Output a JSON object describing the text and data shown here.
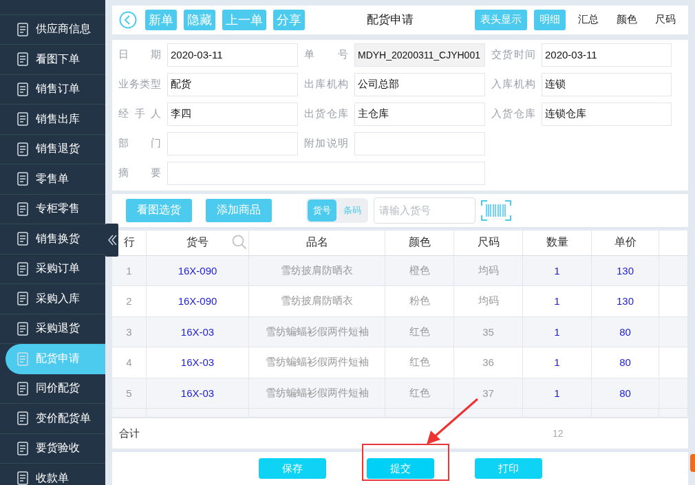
{
  "sidebar": {
    "items": [
      {
        "label": "供应商信息",
        "selected": false
      },
      {
        "label": "看图下单",
        "selected": false
      },
      {
        "label": "销售订单",
        "selected": false
      },
      {
        "label": "销售出库",
        "selected": false
      },
      {
        "label": "销售退货",
        "selected": false
      },
      {
        "label": "零售单",
        "selected": false
      },
      {
        "label": "专柜零售",
        "selected": false
      },
      {
        "label": "销售换货",
        "selected": false
      },
      {
        "label": "采购订单",
        "selected": false
      },
      {
        "label": "采购入库",
        "selected": false
      },
      {
        "label": "采购退货",
        "selected": false
      },
      {
        "label": "配货申请",
        "selected": true
      },
      {
        "label": "同价配货",
        "selected": false
      },
      {
        "label": "变价配货单",
        "selected": false
      },
      {
        "label": "要货验收",
        "selected": false
      },
      {
        "label": "收款单",
        "selected": false
      }
    ]
  },
  "header": {
    "buttons": [
      "新单",
      "隐藏",
      "上一单",
      "分享"
    ],
    "title": "配货申请",
    "toggle_button": "表头显示",
    "views": [
      {
        "label": "明细",
        "selected": true
      },
      {
        "label": "汇总",
        "selected": false
      },
      {
        "label": "颜色",
        "selected": false
      },
      {
        "label": "尺码",
        "selected": false
      }
    ]
  },
  "form": {
    "rows": [
      [
        {
          "label": "日期",
          "value": "2020-03-11",
          "readonly": false,
          "wide": false
        },
        {
          "label": "单号",
          "value": "MDYH_20200311_CJYH001",
          "readonly": true,
          "wide": false
        },
        {
          "label": "交货时间",
          "value": "2020-03-11",
          "readonly": false,
          "wide": false
        }
      ],
      [
        {
          "label": "业务类型",
          "value": "配货",
          "readonly": false,
          "wide": false
        },
        {
          "label": "出库机构",
          "value": "公司总部",
          "readonly": false,
          "wide": false
        },
        {
          "label": "入库机构",
          "value": "连锁",
          "readonly": false,
          "wide": false
        }
      ],
      [
        {
          "label": "经手人",
          "value": "李四",
          "readonly": false,
          "wide": false
        },
        {
          "label": "出货仓库",
          "value": "主仓库",
          "readonly": false,
          "wide": false
        },
        {
          "label": "入货仓库",
          "value": "连锁仓库",
          "readonly": false,
          "wide": false
        }
      ],
      [
        {
          "label": "部门",
          "readonly": false,
          "wide": false
        },
        {
          "label": "附加说明",
          "readonly": false,
          "wide": false
        }
      ],
      [
        {
          "label": "摘要",
          "readonly": false,
          "wide": true
        }
      ]
    ]
  },
  "toolbar": {
    "buttons": [
      "看图选货",
      "添加商品"
    ],
    "modes": [
      {
        "label": "货号",
        "selected": true
      },
      {
        "label": "条码",
        "selected": false
      }
    ],
    "search": {
      "placeholder": "请输入货号"
    }
  },
  "table": {
    "columns": [
      "行",
      "货号",
      "品名",
      "颜色",
      "尺码",
      "数量",
      "单价"
    ],
    "rows": [
      [
        "1",
        "16X-090",
        "雪纺披肩防晒衣",
        "橙色",
        "均码",
        "1",
        "130"
      ],
      [
        "2",
        "16X-090",
        "雪纺披肩防晒衣",
        "粉色",
        "均码",
        "1",
        "130"
      ],
      [
        "3",
        "16X-03",
        "雪纺蝙蝠衫假两件短袖",
        "红色",
        "35",
        "1",
        "80"
      ],
      [
        "4",
        "16X-03",
        "雪纺蝙蝠衫假两件短袖",
        "红色",
        "36",
        "1",
        "80"
      ],
      [
        "5",
        "16X-03",
        "雪纺蝙蝠衫假两件短袖",
        "红色",
        "37",
        "1",
        "80"
      ]
    ],
    "total": {
      "label": "合计",
      "quantity": "12"
    }
  },
  "actions": [
    {
      "label": "保存",
      "highlighted": false
    },
    {
      "label": "提交",
      "highlighted": true
    },
    {
      "label": "打印",
      "highlighted": false
    }
  ]
}
